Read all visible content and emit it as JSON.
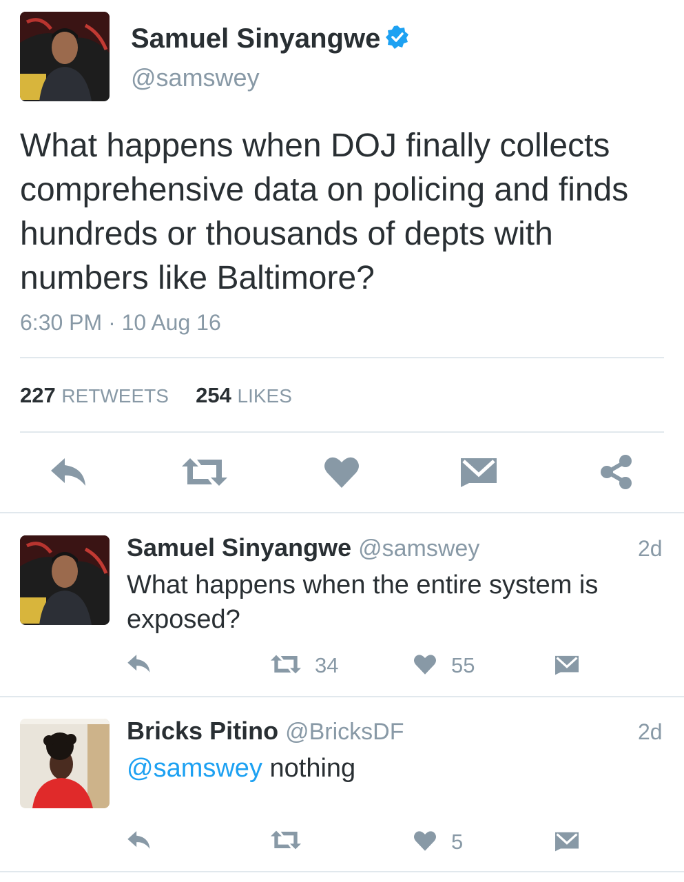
{
  "tweet": {
    "author_name": "Samuel Sinyangwe",
    "author_handle": "@samswey",
    "text": "What happens when DOJ finally collects comprehensive data on policing and finds hundreds or thousands of depts with numbers like Baltimore?",
    "timestamp": "6:30 PM · 10 Aug 16",
    "retweets_count": "227",
    "retweets_label": "RETWEETS",
    "likes_count": "254",
    "likes_label": "LIKES",
    "actions": [
      "reply-icon",
      "retweet-icon",
      "heart-icon",
      "envelope-icon",
      "share-icon"
    ],
    "icon_color": "#8899a6"
  },
  "replies": [
    {
      "author_name": "Samuel Sinyangwe",
      "author_handle": "@samswey",
      "time": "2d",
      "text": "What happens when the entire system is exposed?",
      "retweets": "34",
      "likes": "55"
    },
    {
      "author_name": "Bricks Pitino",
      "author_handle": "@BricksDF",
      "time": "2d",
      "mention": "@samswey",
      "text": "nothing",
      "retweets": "",
      "likes": "5"
    }
  ],
  "colors": {
    "accent": "#1da1f2",
    "muted": "#8899a6",
    "text": "#292f33",
    "divider": "#e1e8ed"
  }
}
